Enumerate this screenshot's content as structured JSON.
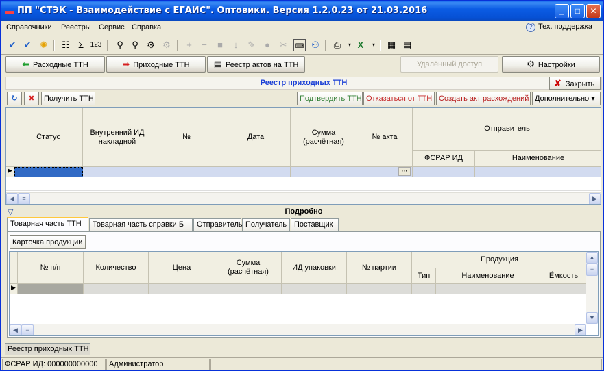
{
  "window": {
    "title": "ПП \"СТЭК - Взаимодействие с ЕГАИС\". Оптовики. Версия 1.2.0.23 от 21.03.2016",
    "controls": [
      "_",
      "□",
      "✕"
    ]
  },
  "menu": {
    "items": [
      "Справочники",
      "Реестры",
      "Сервис",
      "Справка"
    ],
    "support_label": "Тех. поддержка"
  },
  "nav": {
    "expense_ttn": "Расходные ТТН",
    "income_ttn": "Приходные ТТН",
    "acts_registry": "Реестр актов на ТТН",
    "remote_access": "Удалённый доступ",
    "settings": "Настройки"
  },
  "registry": {
    "title": "Реестр приходных ТТН",
    "close_label": "Закрыть",
    "get_ttn": "Получить ТТН",
    "confirm_ttn": "Подтвердить ТТН",
    "reject_ttn": "Отказаться от ТТН",
    "create_act": "Создать акт расхождений",
    "more": "Дополнительно ▾",
    "columns": {
      "status": "Статус",
      "internal_id": "Внутренний ИД накладной",
      "number": "№",
      "date": "Дата",
      "sum": "Сумма (расчётная)",
      "act_number": "№ акта",
      "sender": "Отправитель",
      "fsrar_id": "ФСРАР ИД",
      "name": "Наименование"
    },
    "ellipsis": "···"
  },
  "detail": {
    "title": "Подробно",
    "tabs": [
      "Товарная часть ТТН",
      "Товарная часть справки Б",
      "Отправитель",
      "Получатель",
      "Поставщик"
    ],
    "product_card": "Карточка продукции",
    "columns": {
      "pos": "№ п/п",
      "qty": "Количество",
      "price": "Цена",
      "sum": "Сумма (расчётная)",
      "pack_id": "ИД упаковки",
      "batch": "№ партии",
      "product": "Продукция",
      "type": "Тип",
      "name": "Наименование",
      "capacity": "Ёмкость"
    }
  },
  "bottom_tab": "Реестр приходных ТТН",
  "status": {
    "fsrar": "ФСРАР ИД: 000000000000",
    "user": "Администратор"
  },
  "colors": {
    "title_blue": "#1A3FD6",
    "confirm_green": "#2E7D32",
    "reject_red": "#C62828",
    "create_act_red": "#B71C1C"
  }
}
